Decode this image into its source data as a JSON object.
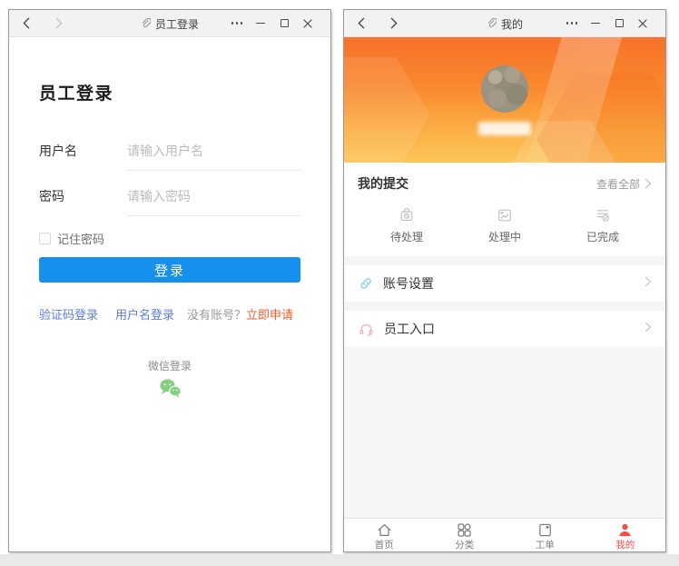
{
  "left_window": {
    "titlebar": {
      "title": "员工登录"
    },
    "heading": "员工登录",
    "form": {
      "username_label": "用户名",
      "username_placeholder": "请输入用户名",
      "password_label": "密码",
      "password_placeholder": "请输入密码",
      "remember_label": "记住密码",
      "login_button": "登录"
    },
    "links": {
      "captcha_login": "验证码登录",
      "username_login": "用户名登录",
      "no_account": "没有账号？",
      "apply_now": "立即申请"
    },
    "wechat_login_label": "微信登录"
  },
  "right_window": {
    "titlebar": {
      "title": "我的"
    },
    "submissions": {
      "title": "我的提交",
      "view_all": "查看全部",
      "statuses": [
        {
          "label": "待处理",
          "icon": "pending-icon"
        },
        {
          "label": "处理中",
          "icon": "processing-icon"
        },
        {
          "label": "已完成",
          "icon": "completed-icon"
        }
      ]
    },
    "menu": [
      {
        "label": "账号设置",
        "icon": "link-icon",
        "color": "#86cdf3"
      },
      {
        "label": "员工入口",
        "icon": "headset-icon",
        "color": "#f6b3cb"
      }
    ],
    "tabbar": [
      {
        "label": "首页",
        "icon": "home-icon",
        "active": false
      },
      {
        "label": "分类",
        "icon": "category-icon",
        "active": false
      },
      {
        "label": "工单",
        "icon": "workorder-icon",
        "active": false
      },
      {
        "label": "我的",
        "icon": "profile-icon",
        "active": true
      }
    ]
  },
  "colors": {
    "primary_button_blue": "#1590ec",
    "link_blue": "#5c7ddb",
    "apply_orange": "#f25b29",
    "header_gradient_top": "#f8712a",
    "header_gradient_bottom": "#fcc558",
    "active_tab_red": "#fb4b4b",
    "wechat_green": "#82cf7d",
    "titlebar_bg": "#f2f2f2"
  }
}
